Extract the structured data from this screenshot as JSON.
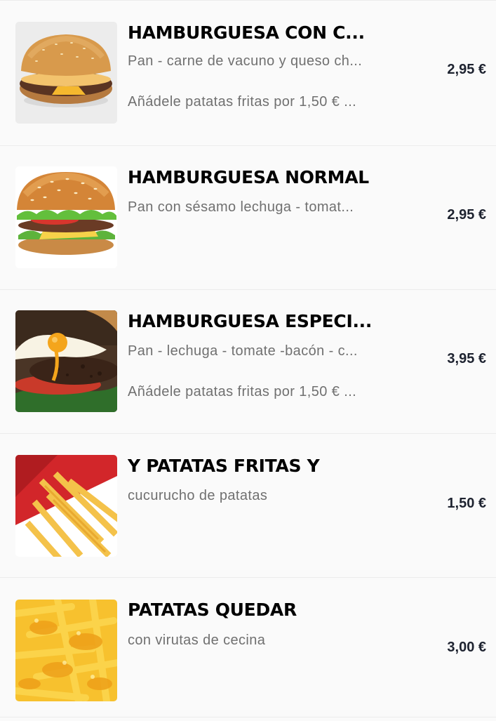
{
  "menu": {
    "items": [
      {
        "name": "HAMBURGUESA CON C...",
        "description": "Pan - carne de vacuno y queso ch...",
        "note": "Añádele patatas fritas por 1,50 € ...",
        "price": "2,95 €",
        "image_icon": "cheeseburger-image"
      },
      {
        "name": "HAMBURGUESA NORMAL",
        "description": "Pan con sésamo lechuga - tomat...",
        "price": "2,95 €",
        "image_icon": "burger-lettuce-image"
      },
      {
        "name": "HAMBURGUESA ESPECI...",
        "description": "Pan - lechuga - tomate -bacón - c...",
        "note": "Añádele patatas fritas por 1,50 € ...",
        "price": "3,95 €",
        "image_icon": "egg-burger-image"
      },
      {
        "name": "Y PATATAS FRITAS Y",
        "description": "cucurucho de patatas",
        "price": "1,50 €",
        "image_icon": "fries-cone-image"
      },
      {
        "name": "PATATAS QUEDAR",
        "description": "con virutas de cecina",
        "price": "3,00 €",
        "image_icon": "cheese-fries-image"
      }
    ]
  }
}
